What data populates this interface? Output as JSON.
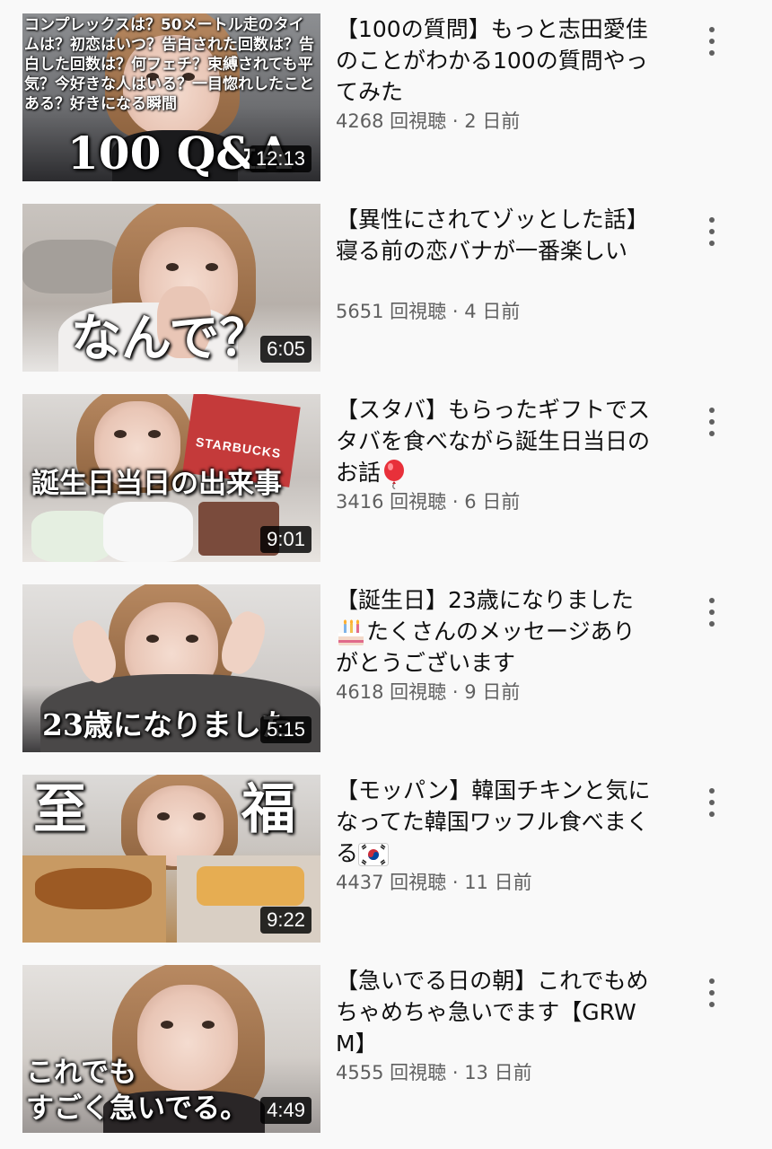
{
  "videos": [
    {
      "title": "【100の質問】もっと志田愛佳のことがわかる100の質問やってみた",
      "views": "4268 回視聴",
      "age": "2 日前",
      "duration": "12:13",
      "thumb_caption": "100 Q&A",
      "thumb_small_text": "コンプレックスは？50メートル走のタイムは？初恋はいつ？告白された回数は？告白した回数は？何フェチ？束縛されても平気？今好きな人はいる？一目惚れしたことある？好きになる瞬間"
    },
    {
      "title": "【異性にされてゾッとした話】寝る前の恋バナが一番楽しい",
      "views": "5651 回視聴",
      "age": "4 日前",
      "duration": "6:05",
      "thumb_caption": "なんで？"
    },
    {
      "title": "【スタバ】もらったギフトでスタバを食べながら誕生日当日のお話",
      "title_emoji": "balloon",
      "views": "3416 回視聴",
      "age": "6 日前",
      "duration": "9:01",
      "thumb_caption": "誕生日当日の出来事",
      "thumb_bag_text": "STARBUCKS"
    },
    {
      "title_part1": "【誕生日】23歳になりました",
      "title_part2": "たくさんのメッセージありがとうございます",
      "title_emoji": "birthday-cake",
      "views": "4618 回視聴",
      "age": "9 日前",
      "duration": "5:15",
      "thumb_caption": "23歳になりました"
    },
    {
      "title": "【モッパン】韓国チキンと気になってた韓国ワッフル食べまくる",
      "title_emoji": "korea-flag",
      "views": "4437 回視聴",
      "age": "11 日前",
      "duration": "9:22",
      "thumb_caption_left": "至",
      "thumb_caption_right": "福"
    },
    {
      "title": "【急いでる日の朝】これでもめちゃめちゃ急いでます【GRWM】",
      "views": "4555 回視聴",
      "age": "13 日前",
      "duration": "4:49",
      "thumb_caption_line1": "これでも",
      "thumb_caption_line2": "すごく急いでる。"
    }
  ],
  "meta_separator": "·",
  "colors": {
    "background": "#f9f9f9",
    "title_text": "#0f0f0f",
    "meta_text": "#606060",
    "duration_bg": "#000000"
  }
}
